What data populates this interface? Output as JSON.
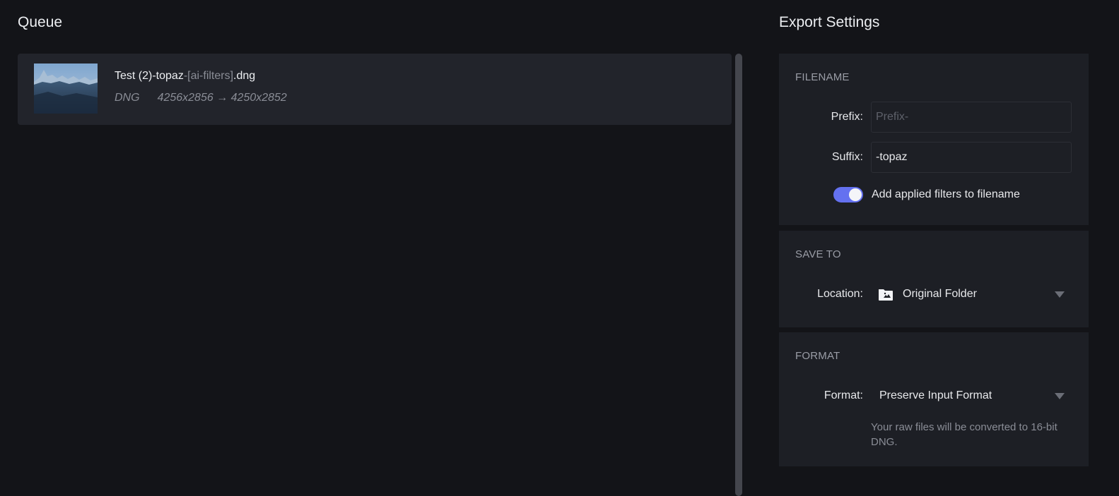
{
  "queue": {
    "title": "Queue",
    "items": [
      {
        "name_base": "Test (2)-topaz",
        "name_filters": "-[ai-filters]",
        "name_ext": ".dng",
        "format": "DNG",
        "resolution": "4256x2856 → 4250x2852"
      }
    ]
  },
  "export": {
    "title": "Export Settings",
    "filename": {
      "section_title": "FILENAME",
      "prefix_label": "Prefix:",
      "prefix_value": "",
      "prefix_placeholder": "Prefix-",
      "suffix_label": "Suffix:",
      "suffix_value": "-topaz",
      "toggle_label": "Add applied filters to filename",
      "toggle_on": true
    },
    "save_to": {
      "section_title": "SAVE TO",
      "location_label": "Location:",
      "location_value": "Original Folder",
      "location_icon": "folder-image-icon"
    },
    "format": {
      "section_title": "FORMAT",
      "format_label": "Format:",
      "format_value": "Preserve Input Format",
      "helper_text": "Your raw files will be converted to 16-bit DNG."
    }
  },
  "colors": {
    "background": "#131418",
    "panel": "#1d1f25",
    "queue_item": "#22242b",
    "accent": "#6471f0"
  }
}
